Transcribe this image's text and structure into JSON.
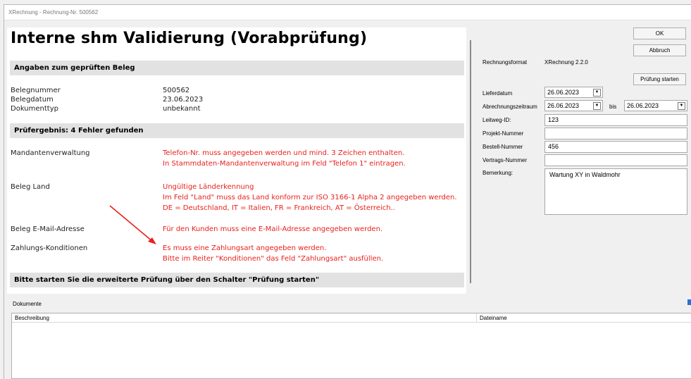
{
  "window": {
    "title": "XRechnung - Rechnung-Nr. 500562"
  },
  "report": {
    "title": "Interne shm Validierung (Vorabprüfung)",
    "section1": "Angaben zum geprüften Beleg",
    "info": [
      {
        "label": "Belegnummer",
        "value": "500562"
      },
      {
        "label": "Belegdatum",
        "value": "23.06.2023"
      },
      {
        "label": "Dokumenttyp",
        "value": "unbekannt"
      }
    ],
    "section2": "Prüfergebnis: 4 Fehler gefunden",
    "errors": [
      {
        "label": "Mandantenverwaltung",
        "lines": [
          "Telefon-Nr. muss angegeben werden und mind. 3 Zeichen enthalten.",
          "In Stammdaten-Mandantenverwaltung im Feld \"Telefon 1\" eintragen."
        ]
      },
      {
        "label": "Beleg Land",
        "lines": [
          "Ungültige Länderkennung",
          "Im Feld \"Land\" muss das Land konform zur ISO 3166-1 Alpha 2 angegeben werden.",
          "DE = Deutschland, IT = Italien, FR = Frankreich, AT = Österreich.."
        ]
      },
      {
        "label": "Beleg E-Mail-Adresse",
        "lines": [
          "Für den Kunden muss eine E-Mail-Adresse angegeben werden."
        ]
      },
      {
        "label": "Zahlungs-Konditionen",
        "lines": [
          "Es muss eine Zahlungsart angegeben werden.",
          "Bitte im Reiter \"Konditionen\" das Feld \"Zahlungsart\" ausfüllen."
        ]
      }
    ],
    "section3": "Bitte starten Sie die erweiterte Prüfung über den Schalter \"Prüfung starten\""
  },
  "buttons": {
    "ok": "OK",
    "abbruch": "Abbruch",
    "pruefung": "Prüfung starten"
  },
  "form": {
    "format_label": "Rechnungsformat",
    "format_value": "XRechnung 2.2.0",
    "lieferdatum_label": "Lieferdatum",
    "lieferdatum": "26.06.2023",
    "abrechnung_label": "Abrechnungszeitraum",
    "abrechnung_von": "26.06.2023",
    "bis_label": "bis",
    "abrechnung_bis": "26.06.2023",
    "leitweg_label": "Leitweg-ID:",
    "leitweg": "123",
    "projekt_label": "Projekt-Nummer",
    "projekt": "",
    "bestell_label": "Bestell-Nummer",
    "bestell": "456",
    "vertrag_label": "Vertrags-Nummer",
    "vertrag": "",
    "bemerkung_label": "Bemerkung:",
    "bemerkung": "Wartung XY in Waldmohr"
  },
  "documents": {
    "label": "Dokumente",
    "columns": [
      "Beschreibung",
      "Dateiname"
    ]
  },
  "colors": {
    "error": "#e8211c",
    "section_bg": "#e2e2e2",
    "arrow": "#e8211c"
  }
}
